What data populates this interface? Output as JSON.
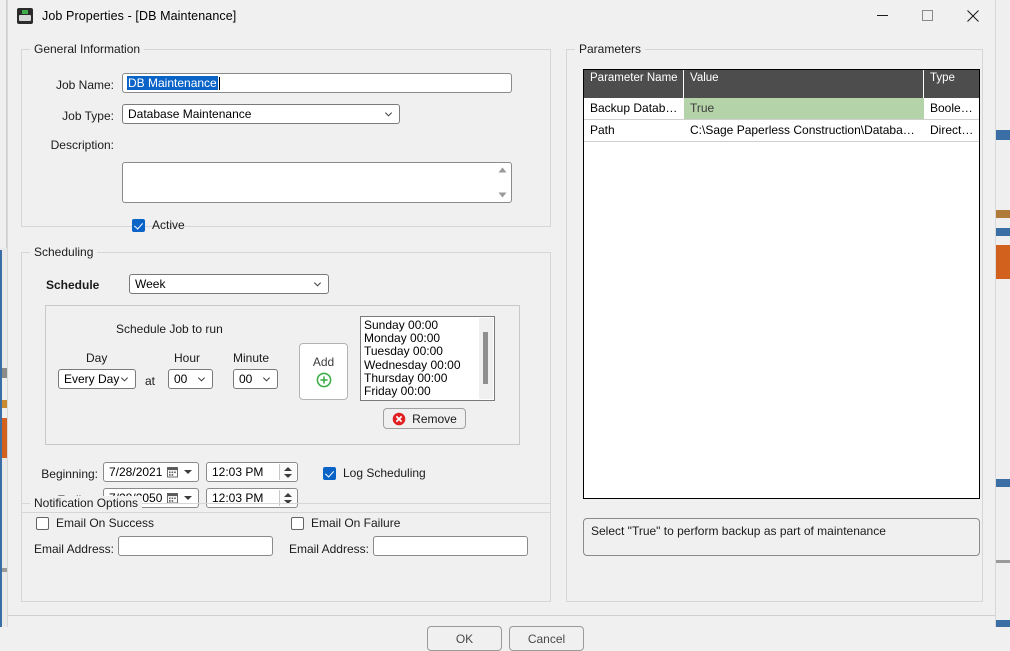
{
  "window": {
    "title": "Job Properties - [DB Maintenance]",
    "icon": "app-icon",
    "minimize_label": "Minimize",
    "maximize_label": "Maximize",
    "close_label": "Close"
  },
  "general": {
    "group_title": "General Information",
    "job_name_label": "Job Name:",
    "job_name_value": "DB Maintenance",
    "job_type_label": "Job Type:",
    "job_type_value": "Database Maintenance",
    "description_label": "Description:",
    "description_value": "",
    "active_label": "Active",
    "active_checked": true
  },
  "scheduling": {
    "group_title": "Scheduling",
    "schedule_label": "Schedule",
    "schedule_value": "Week",
    "panel_title": "Schedule Job to run",
    "day_label": "Day",
    "day_value": "Every Day",
    "at_label": "at",
    "hour_label": "Hour",
    "hour_value": "00",
    "minute_label": "Minute",
    "minute_value": "00",
    "add_label": "Add",
    "remove_label": "Remove",
    "entries": [
      "Sunday 00:00",
      "Monday 00:00",
      "Tuesday 00:00",
      "Wednesday 00:00",
      "Thursday 00:00",
      "Friday 00:00"
    ],
    "beginning_label": "Beginning:",
    "beginning_date": "7/28/2021",
    "beginning_time": "12:03 PM",
    "ending_label": "Ending:",
    "ending_date": "7/28/2050",
    "ending_time": "12:03 PM",
    "log_scheduling_label": "Log Scheduling",
    "log_scheduling_checked": true
  },
  "notification": {
    "group_title": "Notification Options",
    "email_on_success_label": "Email On Success",
    "email_on_success_checked": false,
    "success_email_address_label": "Email Address:",
    "success_email_address_value": "",
    "email_on_failure_label": "Email On Failure",
    "email_on_failure_checked": false,
    "failure_email_address_label": "Email Address:",
    "failure_email_address_value": ""
  },
  "parameters": {
    "group_title": "Parameters",
    "columns": [
      "Parameter Name",
      "Value",
      "Type"
    ],
    "rows": [
      {
        "name": "Backup Database",
        "value": "True",
        "type": "Boolean",
        "highlight": true
      },
      {
        "name": "Path",
        "value": "C:\\Sage Paperless Construction\\Database\\Sql...",
        "type": "Directory",
        "highlight": false
      }
    ],
    "help_text": "Select \"True\" to perform backup as part of maintenance"
  },
  "footer": {
    "ok_label": "OK",
    "cancel_label": "Cancel"
  },
  "colors": {
    "accent_blue": "#0a64c8",
    "grid_header": "#4d4d4d",
    "highlight_green": "#b5d3a8",
    "add_green": "#3fae49",
    "remove_red": "#e02020"
  }
}
